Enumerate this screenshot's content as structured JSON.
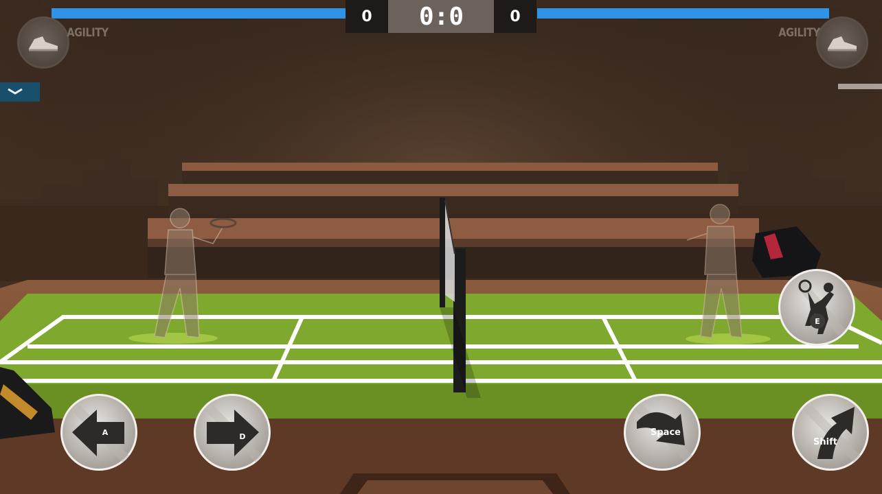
{
  "scoreboard": {
    "left_games": "0",
    "right_games": "0",
    "match_score": "0:0"
  },
  "left_player": {
    "skill_label": "AGILITY",
    "skill_icon": "shoe-icon"
  },
  "right_player": {
    "skill_label": "AGILITY",
    "skill_icon": "shoe-icon"
  },
  "controls": {
    "move_left": {
      "key": "A",
      "icon": "arrow-left-icon"
    },
    "move_right": {
      "key": "D",
      "icon": "arrow-right-icon"
    },
    "jump": {
      "key": "Space",
      "icon": "curved-arrow-down-icon"
    },
    "dash": {
      "key": "Shift",
      "icon": "curved-arrow-up-icon"
    },
    "special": {
      "key": "E",
      "icon": "smash-player-icon"
    }
  },
  "colors": {
    "stamina_bar": "#2f93e6",
    "court": "#7fa82e",
    "court_lines": "#ffffff",
    "collapse_tab": "#1a4f6b"
  }
}
